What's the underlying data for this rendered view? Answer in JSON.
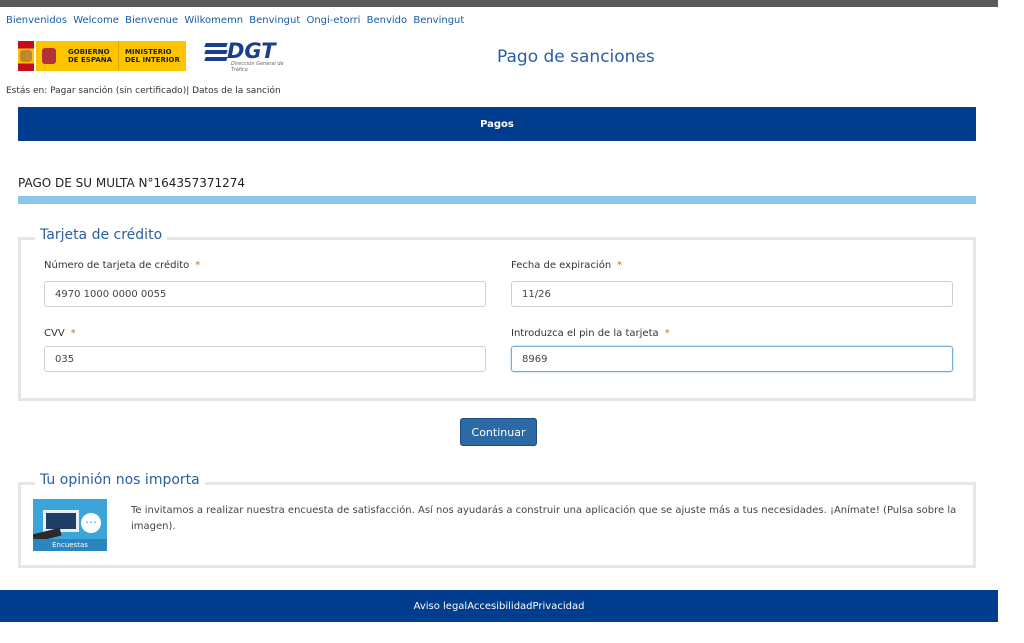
{
  "languages": [
    "Bienvenidos",
    "Welcome",
    "Bienvenue",
    "Wilkomemn",
    "Benvingut",
    "Ongi-etorri",
    "Benvido",
    "Benvingut"
  ],
  "header": {
    "gov_line1": "GOBIERNO",
    "gov_line2": "DE ESPAÑA",
    "ministry_line1": "MINISTERIO",
    "ministry_line2": "DEL INTERIOR",
    "dgt_logo": "DGT",
    "dgt_subtitle": "Dirección General de Tráfico",
    "page_title": "Pago de sanciones"
  },
  "breadcrumb": "Estás en: Pagar sanción (sin certificado)| Datos de la sanción",
  "nav": {
    "item": "Pagos"
  },
  "fine_title": "PAGO DE SU MULTA N°164357371274",
  "card": {
    "legend": "Tarjeta de crédito",
    "required_mark": "*",
    "number_label": "Número de tarjeta de crédito",
    "number_value": "4970 1000 0000 0055",
    "expiry_label": "Fecha de expiración",
    "expiry_value": "11/26",
    "cvv_label": "CVV",
    "cvv_value": "035",
    "pin_label": "Introduzca el pin de la tarjeta",
    "pin_value": "8969"
  },
  "continue_label": "Continuar",
  "opinion": {
    "legend": "Tu opinión nos importa",
    "image_caption": "Encuestas",
    "text": "Te invitamos a realizar nuestra encuesta de satisfacción. Así nos ayudarás a construir una aplicación que se ajuste más a tus necesidades. ¡Anímate! (Pulsa sobre la imagen)."
  },
  "footer": {
    "legal": "Aviso legal",
    "accessibility": "Accesibilidad",
    "privacy": "Privacidad"
  },
  "colors": {
    "nav": "#003d8f",
    "accent": "#2a5ea5",
    "fine_bar": "#8ac6ea",
    "button": "#2c6aa5",
    "required": "#d4681c"
  }
}
